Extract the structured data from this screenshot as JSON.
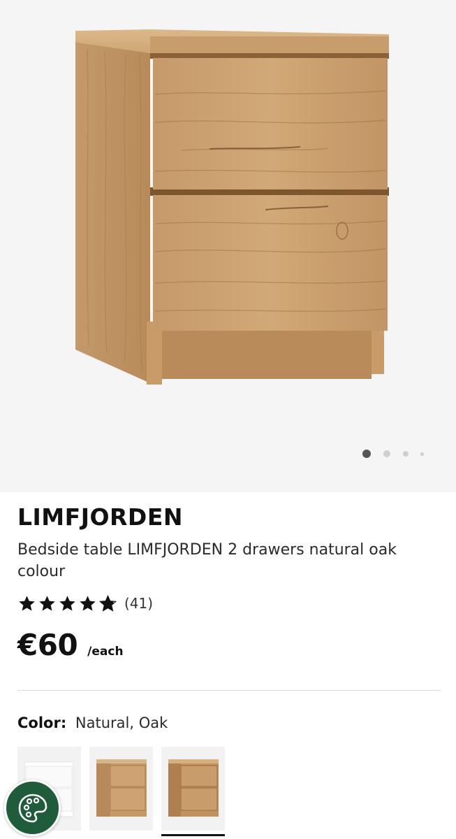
{
  "product": {
    "brand": "LIMFJORDEN",
    "description": "Bedside table LIMFJORDEN 2 drawers natural oak colour",
    "rating": 4.8,
    "review_count": "(41)",
    "price": "€60",
    "price_unit": "/each"
  },
  "gallery": {
    "image_count": 4,
    "active_index": 0,
    "image_icon": "bedside-table-natural-oak"
  },
  "color": {
    "label": "Color:",
    "value": "Natural, Oak",
    "options": [
      {
        "name": "white",
        "icon": "bedside-table-white"
      },
      {
        "name": "natural-oak-light",
        "icon": "bedside-table-oak"
      },
      {
        "name": "natural-oak",
        "icon": "bedside-table-oak",
        "selected": true
      }
    ]
  },
  "cookie_button": {
    "icon": "cookie-palette-icon"
  },
  "colors": {
    "accent_green": "#1f5c3c",
    "oak": "#c79a66",
    "text": "#1a1a1a"
  }
}
